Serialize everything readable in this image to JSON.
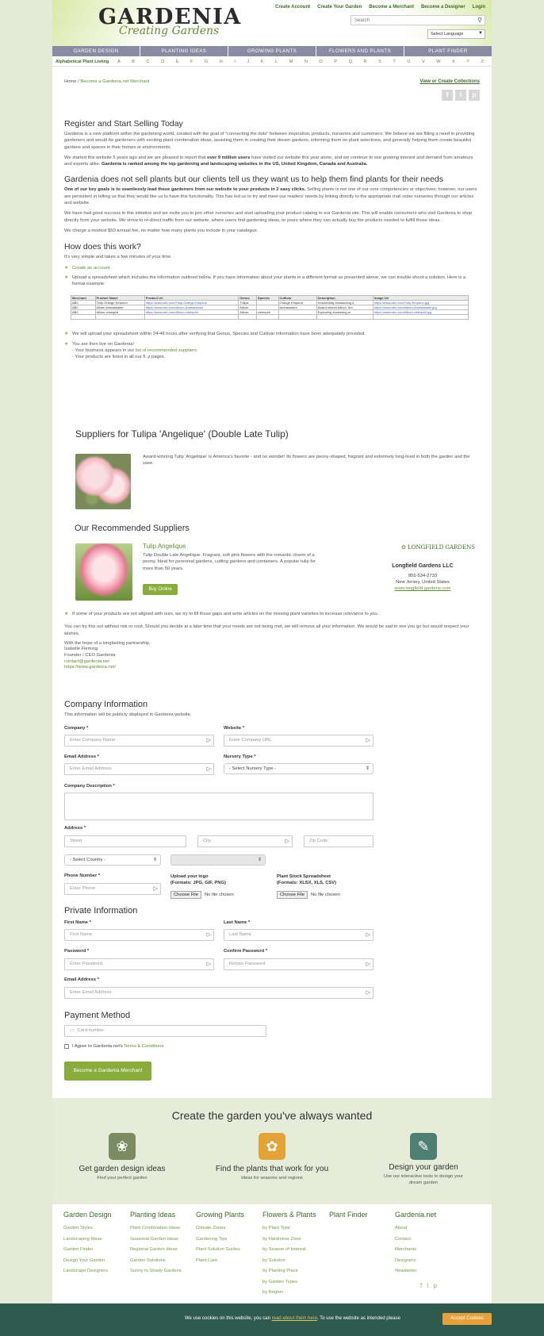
{
  "header": {
    "logo": "GARDENIA",
    "tagline": "Creating Gardens",
    "top_links": [
      "Create Account",
      "Create Your Garden",
      "Become a Merchant",
      "Become a Designer",
      "Login"
    ],
    "search_placeholder": "Search",
    "language": "Select Language"
  },
  "nav": [
    "GARDEN DESIGN",
    "PLANTING IDEAS",
    "GROWING PLANTS",
    "FLOWERS AND PLANTS",
    "PLANT FINDER"
  ],
  "alpha": {
    "label": "Alphabetical Plant Listing",
    "letters": [
      "A",
      "B",
      "C",
      "D",
      "E",
      "F",
      "G",
      "H",
      "I",
      "J",
      "K",
      "L",
      "M",
      "N",
      "O",
      "P",
      "Q",
      "R",
      "S",
      "T",
      "U",
      "V",
      "W",
      "X",
      "Y",
      "Z"
    ]
  },
  "breadcrumb": {
    "home": "Home",
    "sep": "/",
    "current": "Become a Gardenia.net Merchant"
  },
  "view_collections": "View or Create Collections",
  "intro": {
    "h1": "Register and Start Selling Today",
    "p1": "Gardenia is a new platform within the gardening world, created with the goal of \"connecting the dots\" between inspiration, products, nurseries and customers. We believe we are filling a need in providing gardeners and would be gardeners with exciting plant combination ideas, assisting them in creating their dream gardens, informing them on plant selections, and generally helping them create beautiful gardens and spaces in their homes or environments.",
    "p2a": "We started this website 5 years ago and we are pleased to report that ",
    "p2b": "over 9 million users",
    "p2c": " have visited our website this year alone, and we continue to see growing interest and demand from amateurs and experts alike. ",
    "p2d": "Gardenia is ranked among the top gardening and landscaping websites in the US, United Kingdom, Canada and Australia.",
    "h2": "Gardenia does not sell plants but our clients tell us they want us to help them find plants for their needs",
    "p3a": "One of our key goals is to seamlessly lead these gardeners from our website to your products in 2 easy clicks.",
    "p3b": " Selling plants is not one of our core competencies or objectives; however, our users are persistent in telling us that they would like us to have this functionality. This has led us to try and meet our readers' needs by linking directly to the appropriate mail order nurseries through our articles and website.",
    "p4": "We have had good success in this initiative and we invite you to join other nurseries and start uploading your product catalog to our Gardenia site. This will enable consumers who visit Gardenia to shop directly from your website. We strive to re-direct traffic from our website, where users find gardening ideas, to yours where they can actually buy the products needed to fulfill those ideas.",
    "p5": "We charge a modest $50 annual fee, no matter how many plants you include in your catalogue."
  },
  "how": {
    "h": "How does this work?",
    "p": "It's very simple and takes a few minutes of your time.",
    "step1": "Create an account",
    "step2": "Upload a spreadsheet which includes the information outlined below. If you have information about your plants in a different format as presented above, we can trouble-shoot a solution. Here is a format example:",
    "step3": "We will upload your spreadsheet within 24-48 hours after verifying that Genus, Species and Cultivar information have been adequately provided.",
    "step4": "You are then live on Gardenia!",
    "step4a_pre": "- Your business appears in our ",
    "step4a_link": "list of recommended suppliers",
    "step4a_post": ".",
    "step4b": "- Your products are listed in all our fl..y pages."
  },
  "spreadsheet": [
    [
      "Merchant",
      "Product Name",
      "Product Url",
      "Genus",
      "Species",
      "Cultivar",
      "Description",
      "Image Url"
    ],
    [
      "ABC",
      "Tulip Orange Emperor",
      "https://www.abc.com/Tulip-Orange-Emperor",
      "Tulipa",
      "",
      "Orange Emperor",
      "Horizontally blossoming o",
      "https://www.abc.com/Tulip-Emperor.jpg"
    ],
    [
      "ABC",
      "Allium Ambassador",
      "https://www.abc.com/Allium-Ambassador",
      "Allium",
      "",
      "Ambassador",
      "Award-winner Allium 'Am",
      "https://www.abc.com/Allium-Ambassador.jpg"
    ],
    [
      "ABC",
      "Allium cristophii",
      "https://www.abc.com/Allium-cristophii",
      "Allium",
      "cristophii",
      "",
      "Exploding showering al",
      "https://www.abc.com/Allium-cristophii.jpg"
    ],
    [
      "",
      "",
      "",
      "",
      "",
      "",
      "",
      ""
    ]
  ],
  "suppliers": {
    "title": "Suppliers for Tulipa 'Angelique' (Double Late Tulip)",
    "desc": "Award-winning Tulip 'Angelique' is America's favorite - and no wonder! Its flowers are peony-shaped, fragrant and extremely long-lived in both the garden and the vase.",
    "reco_title": "Our Recommended Suppliers",
    "product_name": "Tulip Angelique",
    "product_desc": "Tulip Double Late Angelique. Fragrant, soft pink flowers with the romantic charm of a peony. Ideal for perennial gardens, cutting gardens and containers. A popular tulip for more than 50 years.",
    "buy_label": "Buy Online",
    "vendor_logo": "LONGFIELD GARDENS",
    "vendor_name": "Longfield Gardens LLC",
    "vendor_phone": "855-534-2733",
    "vendor_location": "New Jersey, United States",
    "vendor_url": "www.longfield-gardens.com"
  },
  "outro": {
    "bullet": "If some of your products are not aligned with ours, we try to fill those gaps and write articles on the missing plant varieties to increase relevance to you.",
    "p1": "You can try this out without risk or cost. Should you decide at a later time that your needs are not being met, we will remove all your information. We would be sad to see you go but would respect your wishes.",
    "sign1": "With the hope of a longlasting partnership,",
    "sign2": "Isabelle Fleming",
    "sign3": "Founder / CEO Gardenia",
    "sign4": "contact@gardenia.net",
    "sign5": "https://www.gardenia.net/"
  },
  "company": {
    "h": "Company Information",
    "note": "This information will be publicly displayed in Gardenia website.",
    "company_label": "Company *",
    "company_ph": "Enter Company Name",
    "website_label": "Website *",
    "website_ph": "Enter Company URL",
    "email_label": "Email Address *",
    "email_ph": "Enter Email Address",
    "nursery_label": "Nursery Type *",
    "nursery_value": "- Select Nursery Type -",
    "desc_label": "Company Description *",
    "address_label": "Address *",
    "street_ph": "Street",
    "city_ph": "City",
    "zip_ph": "Zip Code",
    "country_value": "- Select Country -",
    "phone_label": "Phone Number *",
    "phone_ph": "Enter Phone",
    "logo_label": "Upload your logo",
    "logo_formats": "(Formats: JPG, GIF, PNG)",
    "sheet_label": "Plant Stock Spreadsheet",
    "sheet_formats": "(Formats: XLSX, XLS, CSV)",
    "choose_file": "Choose File",
    "no_file": "No file chosen"
  },
  "private": {
    "h": "Private Information",
    "first_label": "First Name *",
    "first_ph": "First Name",
    "last_label": "Last Name *",
    "last_ph": "Last Name",
    "pass_label": "Password *",
    "pass_ph": "Enter Password",
    "confirm_label": "Confirm Password *",
    "confirm_ph": "Retype Password",
    "email_label": "Email Address *",
    "email_ph": "Enter Email Address"
  },
  "payment": {
    "h": "Payment Method",
    "card_ph": "Card number",
    "agree_pre": "I Agree to Gardenia.net's ",
    "agree_link": "Terms & Conditions",
    "submit": "Become a Gardenia Merchant"
  },
  "cta": {
    "h": "Create the garden you've always wanted",
    "items": [
      {
        "title": "Get garden design ideas",
        "sub": "Find your perfect garden",
        "color": "#7b8c63"
      },
      {
        "title": "Find the plants that work for you",
        "sub": "Ideas for seasons and regions",
        "color": "#e2a436"
      },
      {
        "title": "Design your garden",
        "sub": "Use our interactive tools to design your dream garden",
        "color": "#4f7f73"
      }
    ]
  },
  "footer": [
    {
      "h": "Garden Design",
      "items": [
        "Garden Styles",
        "Landscaping Ideas",
        "Garden Finder",
        "Design Your Garden",
        "Landscape Designers"
      ]
    },
    {
      "h": "Planting Ideas",
      "items": [
        "Plant Combination Ideas",
        "Seasonal Garden Ideas",
        "Regional Garden Ideas",
        "Garden Solutions",
        "Sunny to Shady Gardens"
      ]
    },
    {
      "h": "Growing Plants",
      "items": [
        "Climate Zones",
        "Gardening Tips",
        "Plant Solution Guides",
        "Plant Care"
      ]
    },
    {
      "h": "Flowers & Plants",
      "items": [
        "by Plant Type",
        "by Hardiness Zone",
        "by Season of Interest",
        "by Solution",
        "by Planting Place",
        "by Garden Types",
        "by Region"
      ]
    },
    {
      "h": "Plant Finder",
      "items": []
    },
    {
      "h": "Gardenia.net",
      "items": [
        "About",
        "Contact",
        "Merchants",
        "Designers",
        "Newsletter"
      ]
    }
  ],
  "cookie": {
    "pre": "We use cookies on this website, you can ",
    "link": "read about them here",
    "post": ". To use the website as intended please",
    "accept": "Accept Cookies"
  }
}
